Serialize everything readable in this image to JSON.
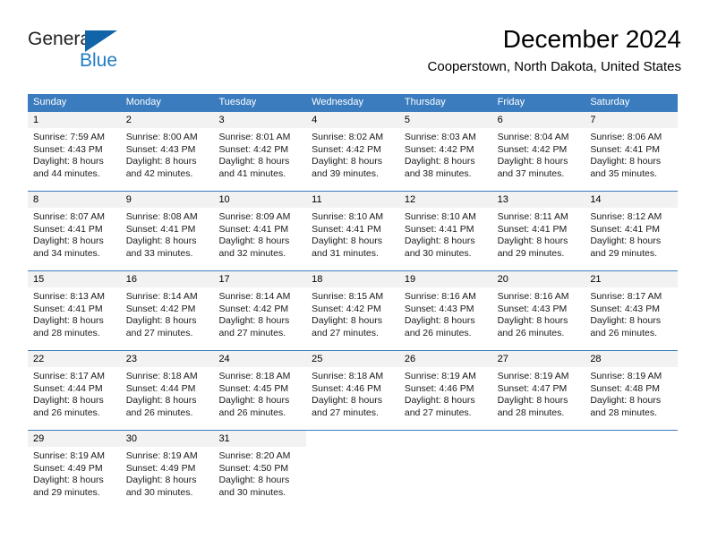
{
  "brand": {
    "name_part1": "General",
    "name_part2": "Blue",
    "logo_icon": "blue-triangle-icon"
  },
  "header": {
    "title": "December 2024",
    "location": "Cooperstown, North Dakota, United States"
  },
  "colors": {
    "header_blue": "#3b7cbe",
    "brand_blue": "#1f7cc4",
    "logo_blue": "#1164a8",
    "daynum_band": "#f2f2f2"
  },
  "weekdays": [
    "Sunday",
    "Monday",
    "Tuesday",
    "Wednesday",
    "Thursday",
    "Friday",
    "Saturday"
  ],
  "weeks": [
    [
      {
        "day": "1",
        "sunrise": "Sunrise: 7:59 AM",
        "sunset": "Sunset: 4:43 PM",
        "daylight1": "Daylight: 8 hours",
        "daylight2": "and 44 minutes."
      },
      {
        "day": "2",
        "sunrise": "Sunrise: 8:00 AM",
        "sunset": "Sunset: 4:43 PM",
        "daylight1": "Daylight: 8 hours",
        "daylight2": "and 42 minutes."
      },
      {
        "day": "3",
        "sunrise": "Sunrise: 8:01 AM",
        "sunset": "Sunset: 4:42 PM",
        "daylight1": "Daylight: 8 hours",
        "daylight2": "and 41 minutes."
      },
      {
        "day": "4",
        "sunrise": "Sunrise: 8:02 AM",
        "sunset": "Sunset: 4:42 PM",
        "daylight1": "Daylight: 8 hours",
        "daylight2": "and 39 minutes."
      },
      {
        "day": "5",
        "sunrise": "Sunrise: 8:03 AM",
        "sunset": "Sunset: 4:42 PM",
        "daylight1": "Daylight: 8 hours",
        "daylight2": "and 38 minutes."
      },
      {
        "day": "6",
        "sunrise": "Sunrise: 8:04 AM",
        "sunset": "Sunset: 4:42 PM",
        "daylight1": "Daylight: 8 hours",
        "daylight2": "and 37 minutes."
      },
      {
        "day": "7",
        "sunrise": "Sunrise: 8:06 AM",
        "sunset": "Sunset: 4:41 PM",
        "daylight1": "Daylight: 8 hours",
        "daylight2": "and 35 minutes."
      }
    ],
    [
      {
        "day": "8",
        "sunrise": "Sunrise: 8:07 AM",
        "sunset": "Sunset: 4:41 PM",
        "daylight1": "Daylight: 8 hours",
        "daylight2": "and 34 minutes."
      },
      {
        "day": "9",
        "sunrise": "Sunrise: 8:08 AM",
        "sunset": "Sunset: 4:41 PM",
        "daylight1": "Daylight: 8 hours",
        "daylight2": "and 33 minutes."
      },
      {
        "day": "10",
        "sunrise": "Sunrise: 8:09 AM",
        "sunset": "Sunset: 4:41 PM",
        "daylight1": "Daylight: 8 hours",
        "daylight2": "and 32 minutes."
      },
      {
        "day": "11",
        "sunrise": "Sunrise: 8:10 AM",
        "sunset": "Sunset: 4:41 PM",
        "daylight1": "Daylight: 8 hours",
        "daylight2": "and 31 minutes."
      },
      {
        "day": "12",
        "sunrise": "Sunrise: 8:10 AM",
        "sunset": "Sunset: 4:41 PM",
        "daylight1": "Daylight: 8 hours",
        "daylight2": "and 30 minutes."
      },
      {
        "day": "13",
        "sunrise": "Sunrise: 8:11 AM",
        "sunset": "Sunset: 4:41 PM",
        "daylight1": "Daylight: 8 hours",
        "daylight2": "and 29 minutes."
      },
      {
        "day": "14",
        "sunrise": "Sunrise: 8:12 AM",
        "sunset": "Sunset: 4:41 PM",
        "daylight1": "Daylight: 8 hours",
        "daylight2": "and 29 minutes."
      }
    ],
    [
      {
        "day": "15",
        "sunrise": "Sunrise: 8:13 AM",
        "sunset": "Sunset: 4:41 PM",
        "daylight1": "Daylight: 8 hours",
        "daylight2": "and 28 minutes."
      },
      {
        "day": "16",
        "sunrise": "Sunrise: 8:14 AM",
        "sunset": "Sunset: 4:42 PM",
        "daylight1": "Daylight: 8 hours",
        "daylight2": "and 27 minutes."
      },
      {
        "day": "17",
        "sunrise": "Sunrise: 8:14 AM",
        "sunset": "Sunset: 4:42 PM",
        "daylight1": "Daylight: 8 hours",
        "daylight2": "and 27 minutes."
      },
      {
        "day": "18",
        "sunrise": "Sunrise: 8:15 AM",
        "sunset": "Sunset: 4:42 PM",
        "daylight1": "Daylight: 8 hours",
        "daylight2": "and 27 minutes."
      },
      {
        "day": "19",
        "sunrise": "Sunrise: 8:16 AM",
        "sunset": "Sunset: 4:43 PM",
        "daylight1": "Daylight: 8 hours",
        "daylight2": "and 26 minutes."
      },
      {
        "day": "20",
        "sunrise": "Sunrise: 8:16 AM",
        "sunset": "Sunset: 4:43 PM",
        "daylight1": "Daylight: 8 hours",
        "daylight2": "and 26 minutes."
      },
      {
        "day": "21",
        "sunrise": "Sunrise: 8:17 AM",
        "sunset": "Sunset: 4:43 PM",
        "daylight1": "Daylight: 8 hours",
        "daylight2": "and 26 minutes."
      }
    ],
    [
      {
        "day": "22",
        "sunrise": "Sunrise: 8:17 AM",
        "sunset": "Sunset: 4:44 PM",
        "daylight1": "Daylight: 8 hours",
        "daylight2": "and 26 minutes."
      },
      {
        "day": "23",
        "sunrise": "Sunrise: 8:18 AM",
        "sunset": "Sunset: 4:44 PM",
        "daylight1": "Daylight: 8 hours",
        "daylight2": "and 26 minutes."
      },
      {
        "day": "24",
        "sunrise": "Sunrise: 8:18 AM",
        "sunset": "Sunset: 4:45 PM",
        "daylight1": "Daylight: 8 hours",
        "daylight2": "and 26 minutes."
      },
      {
        "day": "25",
        "sunrise": "Sunrise: 8:18 AM",
        "sunset": "Sunset: 4:46 PM",
        "daylight1": "Daylight: 8 hours",
        "daylight2": "and 27 minutes."
      },
      {
        "day": "26",
        "sunrise": "Sunrise: 8:19 AM",
        "sunset": "Sunset: 4:46 PM",
        "daylight1": "Daylight: 8 hours",
        "daylight2": "and 27 minutes."
      },
      {
        "day": "27",
        "sunrise": "Sunrise: 8:19 AM",
        "sunset": "Sunset: 4:47 PM",
        "daylight1": "Daylight: 8 hours",
        "daylight2": "and 28 minutes."
      },
      {
        "day": "28",
        "sunrise": "Sunrise: 8:19 AM",
        "sunset": "Sunset: 4:48 PM",
        "daylight1": "Daylight: 8 hours",
        "daylight2": "and 28 minutes."
      }
    ],
    [
      {
        "day": "29",
        "sunrise": "Sunrise: 8:19 AM",
        "sunset": "Sunset: 4:49 PM",
        "daylight1": "Daylight: 8 hours",
        "daylight2": "and 29 minutes."
      },
      {
        "day": "30",
        "sunrise": "Sunrise: 8:19 AM",
        "sunset": "Sunset: 4:49 PM",
        "daylight1": "Daylight: 8 hours",
        "daylight2": "and 30 minutes."
      },
      {
        "day": "31",
        "sunrise": "Sunrise: 8:20 AM",
        "sunset": "Sunset: 4:50 PM",
        "daylight1": "Daylight: 8 hours",
        "daylight2": "and 30 minutes."
      },
      {
        "day": "",
        "sunrise": "",
        "sunset": "",
        "daylight1": "",
        "daylight2": ""
      },
      {
        "day": "",
        "sunrise": "",
        "sunset": "",
        "daylight1": "",
        "daylight2": ""
      },
      {
        "day": "",
        "sunrise": "",
        "sunset": "",
        "daylight1": "",
        "daylight2": ""
      },
      {
        "day": "",
        "sunrise": "",
        "sunset": "",
        "daylight1": "",
        "daylight2": ""
      }
    ]
  ]
}
